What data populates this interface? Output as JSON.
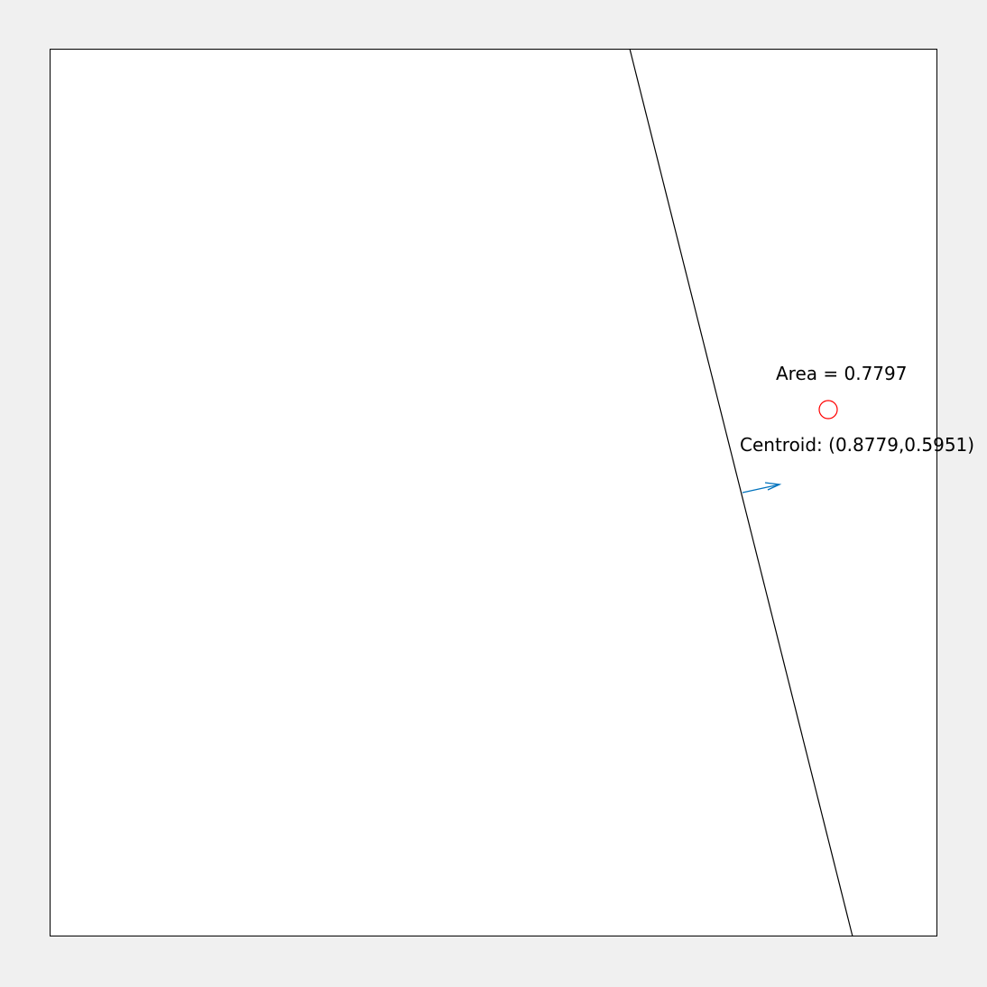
{
  "annotations": {
    "area_label": "Area = 0.7797",
    "centroid_label": "Centroid: (0.8779,0.5951)"
  },
  "colors": {
    "figure_background": "#f0f0f0",
    "axes_background": "#ffffff",
    "line": "#000000",
    "centroid_marker": "#ff0000",
    "normal_arrow": "#0072bd"
  },
  "icons": {
    "centroid_marker": "circle-marker",
    "normal_arrow": "arrow"
  }
}
